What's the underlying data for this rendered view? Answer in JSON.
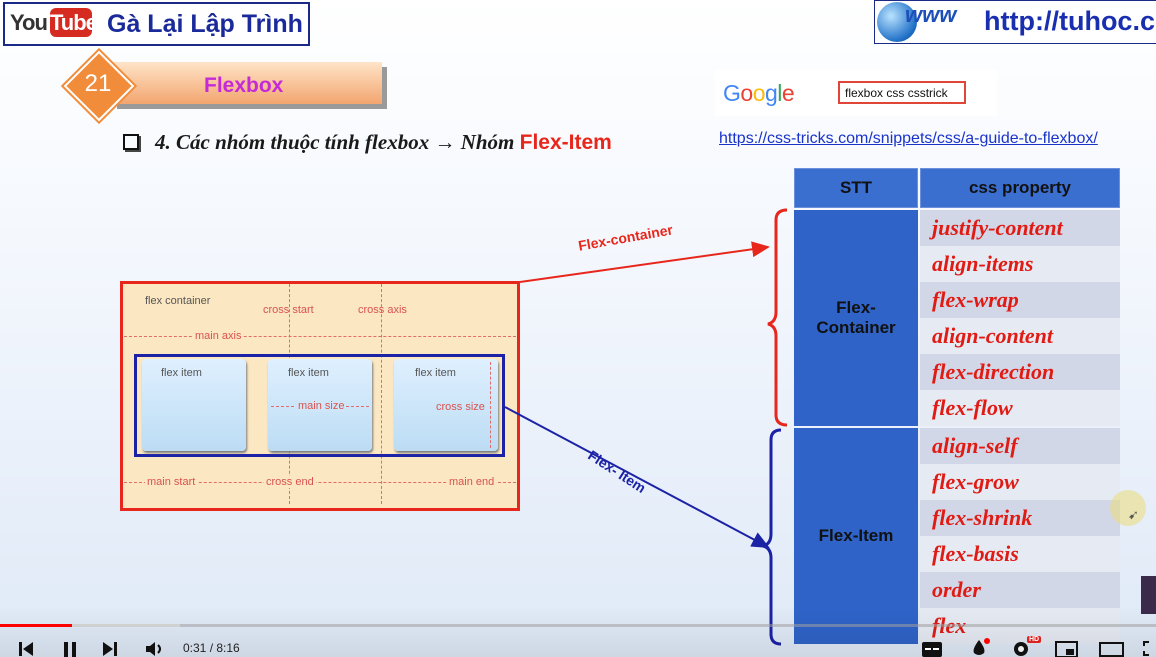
{
  "header": {
    "logo_you": "You",
    "logo_tube": "Tube",
    "channel_name": "Gà Lại Lập Trình",
    "site_url": "http://tuhoc.c",
    "site_www": "www"
  },
  "lesson": {
    "number": "21",
    "title": "Flexbox"
  },
  "google": {
    "logo_letters": [
      "G",
      "o",
      "o",
      "g",
      "l",
      "e"
    ],
    "logo_colors": [
      "#4285F4",
      "#EA4335",
      "#FBBC05",
      "#4285F4",
      "#34A853",
      "#EA4335"
    ],
    "search_query": "flexbox css csstrick",
    "link": "https://css-tricks.com/snippets/css/a-guide-to-flexbox/"
  },
  "heading": {
    "text": "4. Các nhóm thuộc tính flexbox → Nhóm ",
    "highlight": "Flex-Item"
  },
  "diagram": {
    "container_label": "flex container",
    "cross_start": "cross start",
    "cross_axis": "cross axis",
    "main_axis": "main axis",
    "item_label": "flex item",
    "main_size": "main size",
    "cross_size": "cross size",
    "main_start": "main start",
    "cross_end": "cross end",
    "main_end": "main end",
    "arrow_container": "Flex-container",
    "arrow_item": "Flex- Item"
  },
  "table": {
    "headers": [
      "STT",
      "css property"
    ],
    "groups": [
      {
        "label_line1": "Flex-",
        "label_line2": "Container",
        "properties": [
          "justify-content",
          "align-items",
          "flex-wrap",
          "align-content",
          "flex-direction",
          "flex-flow"
        ]
      },
      {
        "label_line1": "Flex-Item",
        "label_line2": "",
        "properties": [
          "align-self",
          "flex-grow",
          "flex-shrink",
          "flex-basis",
          "order",
          "flex"
        ]
      }
    ]
  },
  "player": {
    "time": "0:31 / 8:16",
    "progress_fraction": 0.0625,
    "hd_badge": "HD"
  }
}
